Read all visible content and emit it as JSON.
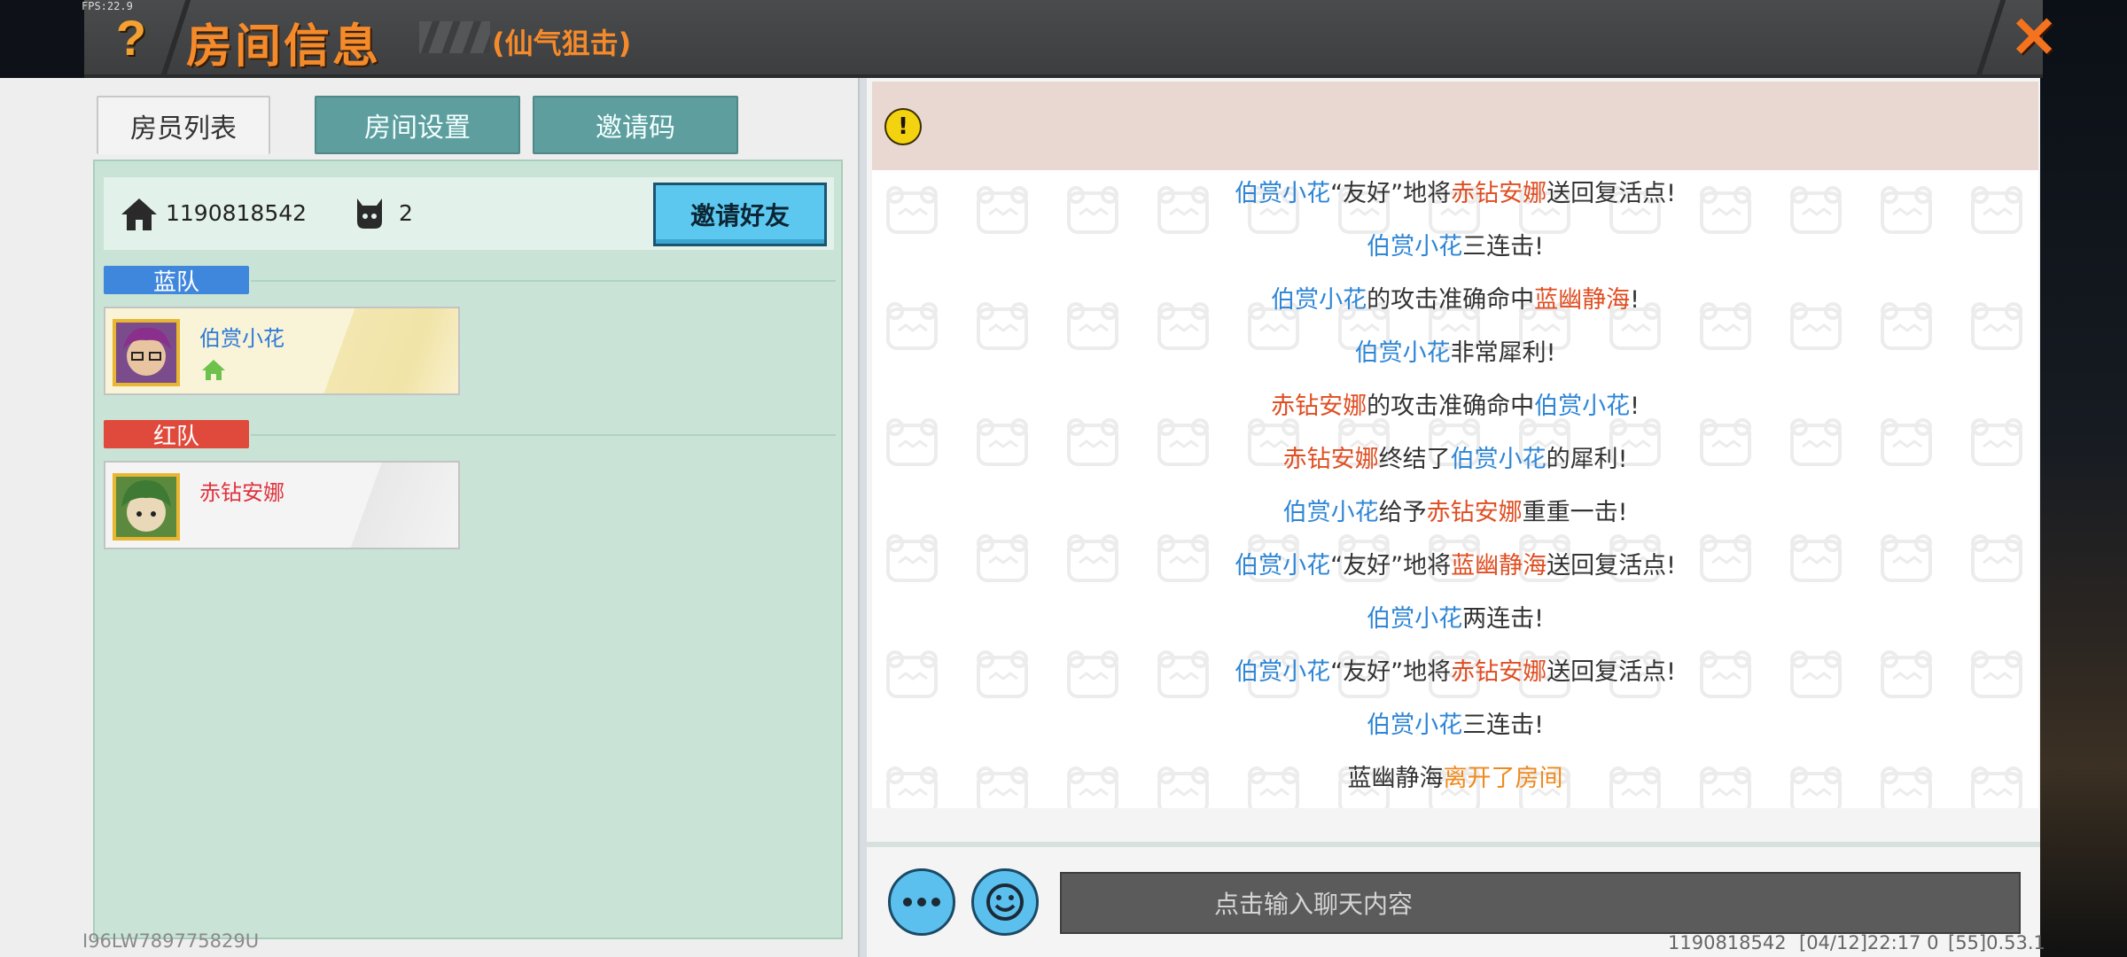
{
  "fps": "FPS:22.9",
  "header": {
    "help_icon": "?",
    "title": "房间信息",
    "subtitle": "(仙气狙击)",
    "close_icon": "✕"
  },
  "tabs": [
    {
      "label": "房员列表",
      "active": true
    },
    {
      "label": "房间设置",
      "active": false
    },
    {
      "label": "邀请码",
      "active": false
    }
  ],
  "room": {
    "id": "1190818542",
    "player_count": "2",
    "invite_button": "邀请好友"
  },
  "teams": {
    "blue": {
      "label": "蓝队",
      "color": "#3f87dc",
      "members": [
        {
          "name": "伯赏小花",
          "is_host": true
        }
      ]
    },
    "red": {
      "label": "红队",
      "color": "#e04a3c",
      "members": [
        {
          "name": "赤钻安娜",
          "is_host": false
        }
      ]
    }
  },
  "chat": {
    "messages": [
      {
        "parts": [
          {
            "t": "伯赏小花",
            "c": "blue"
          },
          {
            "t": "“友好”地将",
            "c": ""
          },
          {
            "t": "赤钻安娜",
            "c": "red"
          },
          {
            "t": "送回复活点!",
            "c": ""
          }
        ]
      },
      {
        "parts": [
          {
            "t": "伯赏小花",
            "c": "blue"
          },
          {
            "t": "三连击!",
            "c": ""
          }
        ]
      },
      {
        "parts": [
          {
            "t": "伯赏小花",
            "c": "blue"
          },
          {
            "t": "的攻击准确命中",
            "c": ""
          },
          {
            "t": "蓝幽静海",
            "c": "red"
          },
          {
            "t": "!",
            "c": ""
          }
        ]
      },
      {
        "parts": [
          {
            "t": "伯赏小花",
            "c": "blue"
          },
          {
            "t": "非常犀利!",
            "c": ""
          }
        ]
      },
      {
        "parts": [
          {
            "t": "赤钻安娜",
            "c": "red"
          },
          {
            "t": "的攻击准确命中",
            "c": ""
          },
          {
            "t": "伯赏小花",
            "c": "blue"
          },
          {
            "t": "!",
            "c": ""
          }
        ]
      },
      {
        "parts": [
          {
            "t": "赤钻安娜",
            "c": "red"
          },
          {
            "t": "终结了",
            "c": ""
          },
          {
            "t": "伯赏小花",
            "c": "blue"
          },
          {
            "t": "的犀利!",
            "c": ""
          }
        ]
      },
      {
        "parts": [
          {
            "t": "伯赏小花",
            "c": "blue"
          },
          {
            "t": "给予",
            "c": ""
          },
          {
            "t": "赤钻安娜",
            "c": "red"
          },
          {
            "t": "重重一击!",
            "c": ""
          }
        ]
      },
      {
        "parts": [
          {
            "t": "伯赏小花",
            "c": "blue"
          },
          {
            "t": "“友好”地将",
            "c": ""
          },
          {
            "t": "蓝幽静海",
            "c": "red"
          },
          {
            "t": "送回复活点!",
            "c": ""
          }
        ]
      },
      {
        "parts": [
          {
            "t": "伯赏小花",
            "c": "blue"
          },
          {
            "t": "两连击!",
            "c": ""
          }
        ]
      },
      {
        "parts": [
          {
            "t": "伯赏小花",
            "c": "blue"
          },
          {
            "t": "“友好”地将",
            "c": ""
          },
          {
            "t": "赤钻安娜",
            "c": "red"
          },
          {
            "t": "送回复活点!",
            "c": ""
          }
        ]
      },
      {
        "parts": [
          {
            "t": "伯赏小花",
            "c": "blue"
          },
          {
            "t": "三连击!",
            "c": ""
          }
        ]
      },
      {
        "parts": [
          {
            "t": "蓝幽静海",
            "c": ""
          },
          {
            "t": "离开了房间",
            "c": "orange"
          }
        ]
      }
    ],
    "input_placeholder": "点击输入聊天内容",
    "more_icon": "···"
  },
  "footer": {
    "left_id": "I96LW789775829U",
    "uid": "1190818542",
    "timestamp": "[04/12]22:17 0",
    "version": "[55]0.53.1"
  },
  "colors": {
    "title_orange": "#f58a2a",
    "blue_name": "#2f86d6",
    "red_name": "#e04e22",
    "accent_button": "#5cc8f0"
  }
}
